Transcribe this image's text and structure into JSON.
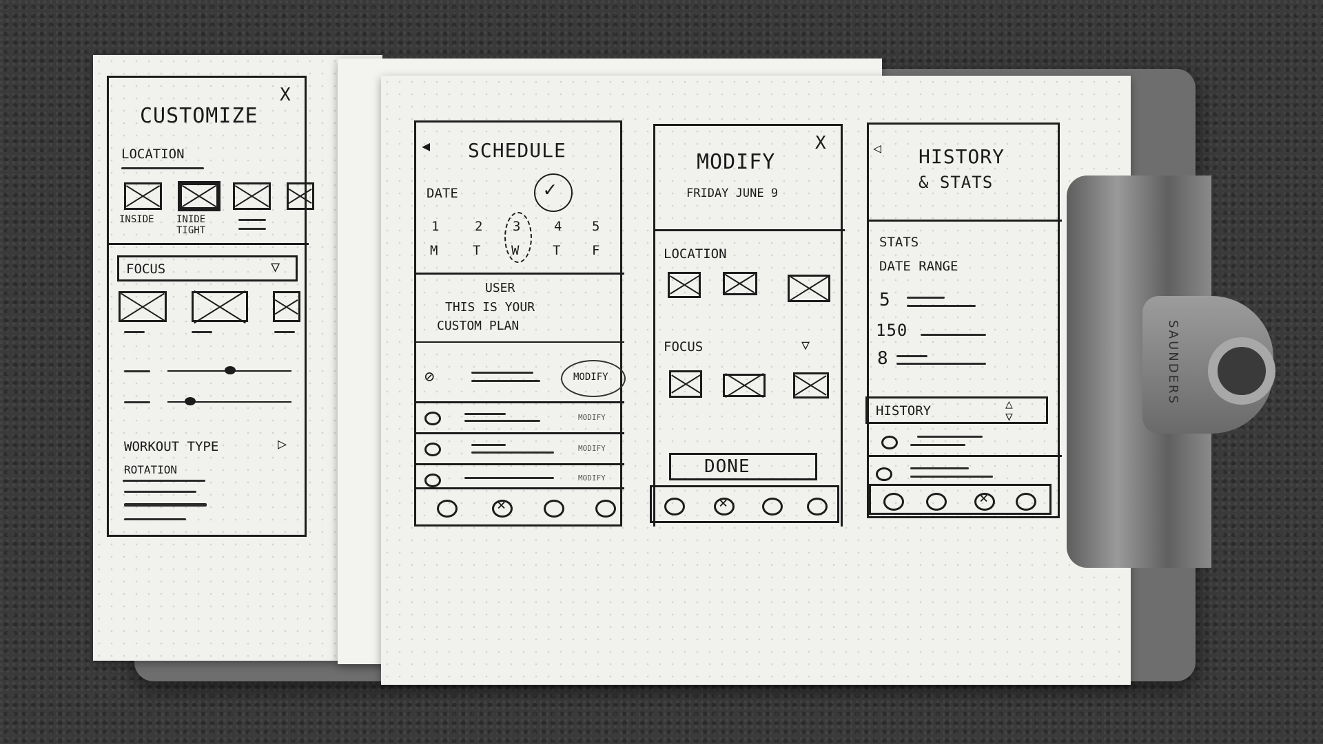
{
  "customize": {
    "title": "CUSTOMIZE",
    "close": "X",
    "location": "LOCATION",
    "opt_inside": "INSIDE",
    "opt_inside_tight": "INIDE TIGHT",
    "focus": "FOCUS",
    "workout_type": "WORKOUT TYPE",
    "rotation": "ROTATION"
  },
  "schedule": {
    "title": "SCHEDULE",
    "date": "DATE",
    "day_numbers": [
      "1",
      "2",
      "3",
      "4",
      "5"
    ],
    "day_letters": [
      "M",
      "T",
      "W",
      "T",
      "F"
    ],
    "user_heading": "USER",
    "user_line1": "THIS IS YOUR",
    "user_line2": "CUSTOM PLAN",
    "modify_label": "MODIFY",
    "modify_small": "MODIFY"
  },
  "modify": {
    "title": "MODIFY",
    "subtitle": "FRIDAY JUNE 9",
    "close": "X",
    "location": "LOCATION",
    "focus": "FOCUS",
    "done": "DONE"
  },
  "history": {
    "title_line1": "HISTORY",
    "title_line2": "& STATS",
    "stats": "STATS",
    "date_range": "DATE RANGE",
    "stat_values": [
      "5",
      "150",
      "8"
    ],
    "history": "HISTORY"
  },
  "clip": {
    "brand": "SAUNDERS"
  },
  "icons": {
    "back": "back-arrow-icon",
    "close": "close-icon",
    "dropdown": "triangle-down-icon",
    "sort": "sort-arrows-icon",
    "check": "checkmark-icon"
  }
}
